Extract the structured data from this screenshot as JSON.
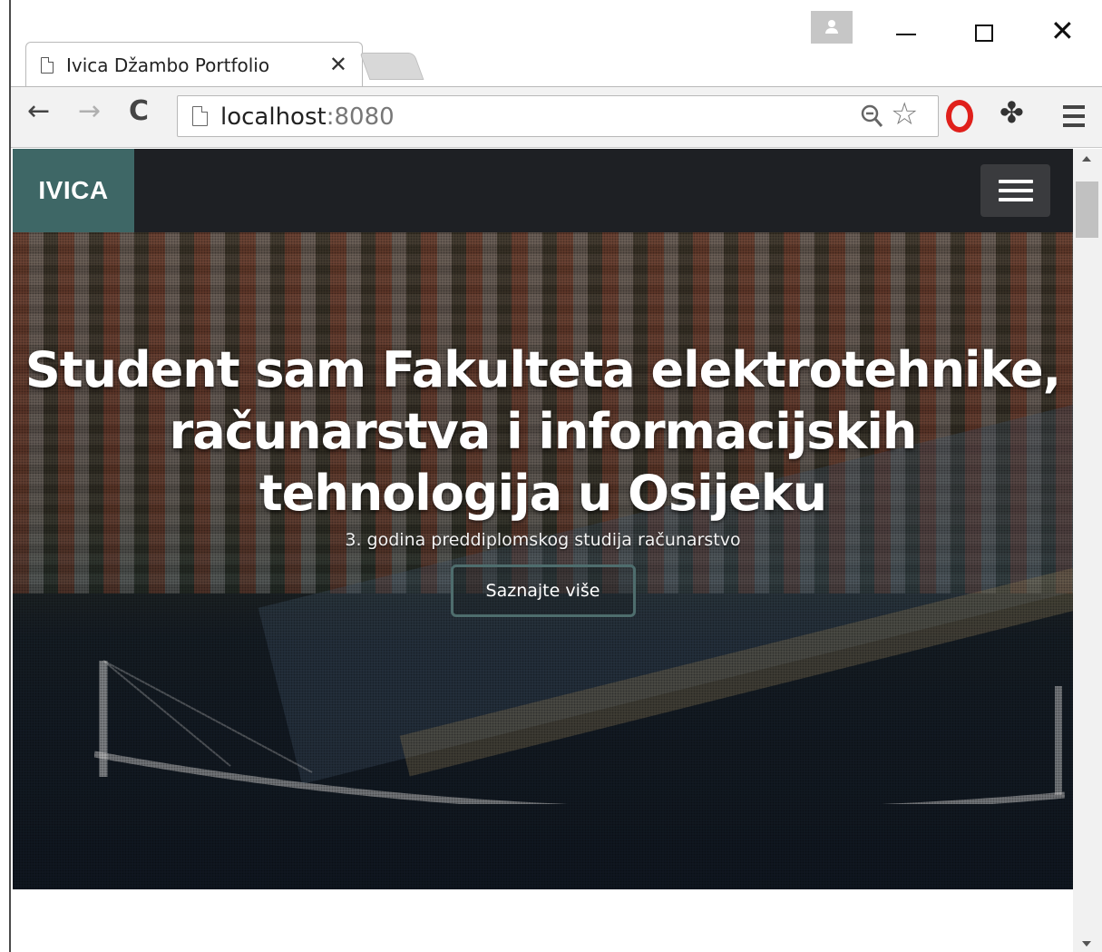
{
  "browser": {
    "tab": {
      "title": "Ivica Džambo Portfolio",
      "close_glyph": "✕",
      "icon": "document-icon"
    },
    "window_controls": {
      "close_glyph": "✕"
    },
    "toolbar": {
      "back_glyph": "←",
      "forward_glyph": "→",
      "reload_glyph": "C",
      "url_host": "localhost",
      "url_port": ":8080",
      "star_glyph": "☆",
      "puzzle_glyph": "✤"
    },
    "icons": [
      "document-icon",
      "profile-icon",
      "zoom-out-icon",
      "star-icon",
      "opera-icon",
      "extensions-icon",
      "menu-icon"
    ]
  },
  "site": {
    "brand": "IVICA",
    "hero": {
      "title": "Student sam Fakulteta elektrotehnike, računarstva i informacijskih tehnologija u Osijeku",
      "subtitle": "3. godina preddiplomskog studija računarstvo",
      "button_label": "Saznajte više"
    }
  },
  "colors": {
    "nav_bg": "#1e2024",
    "brand_bg": "#3e6766",
    "button_border": "#4e6d6d",
    "opera_red": "#e0201b"
  }
}
